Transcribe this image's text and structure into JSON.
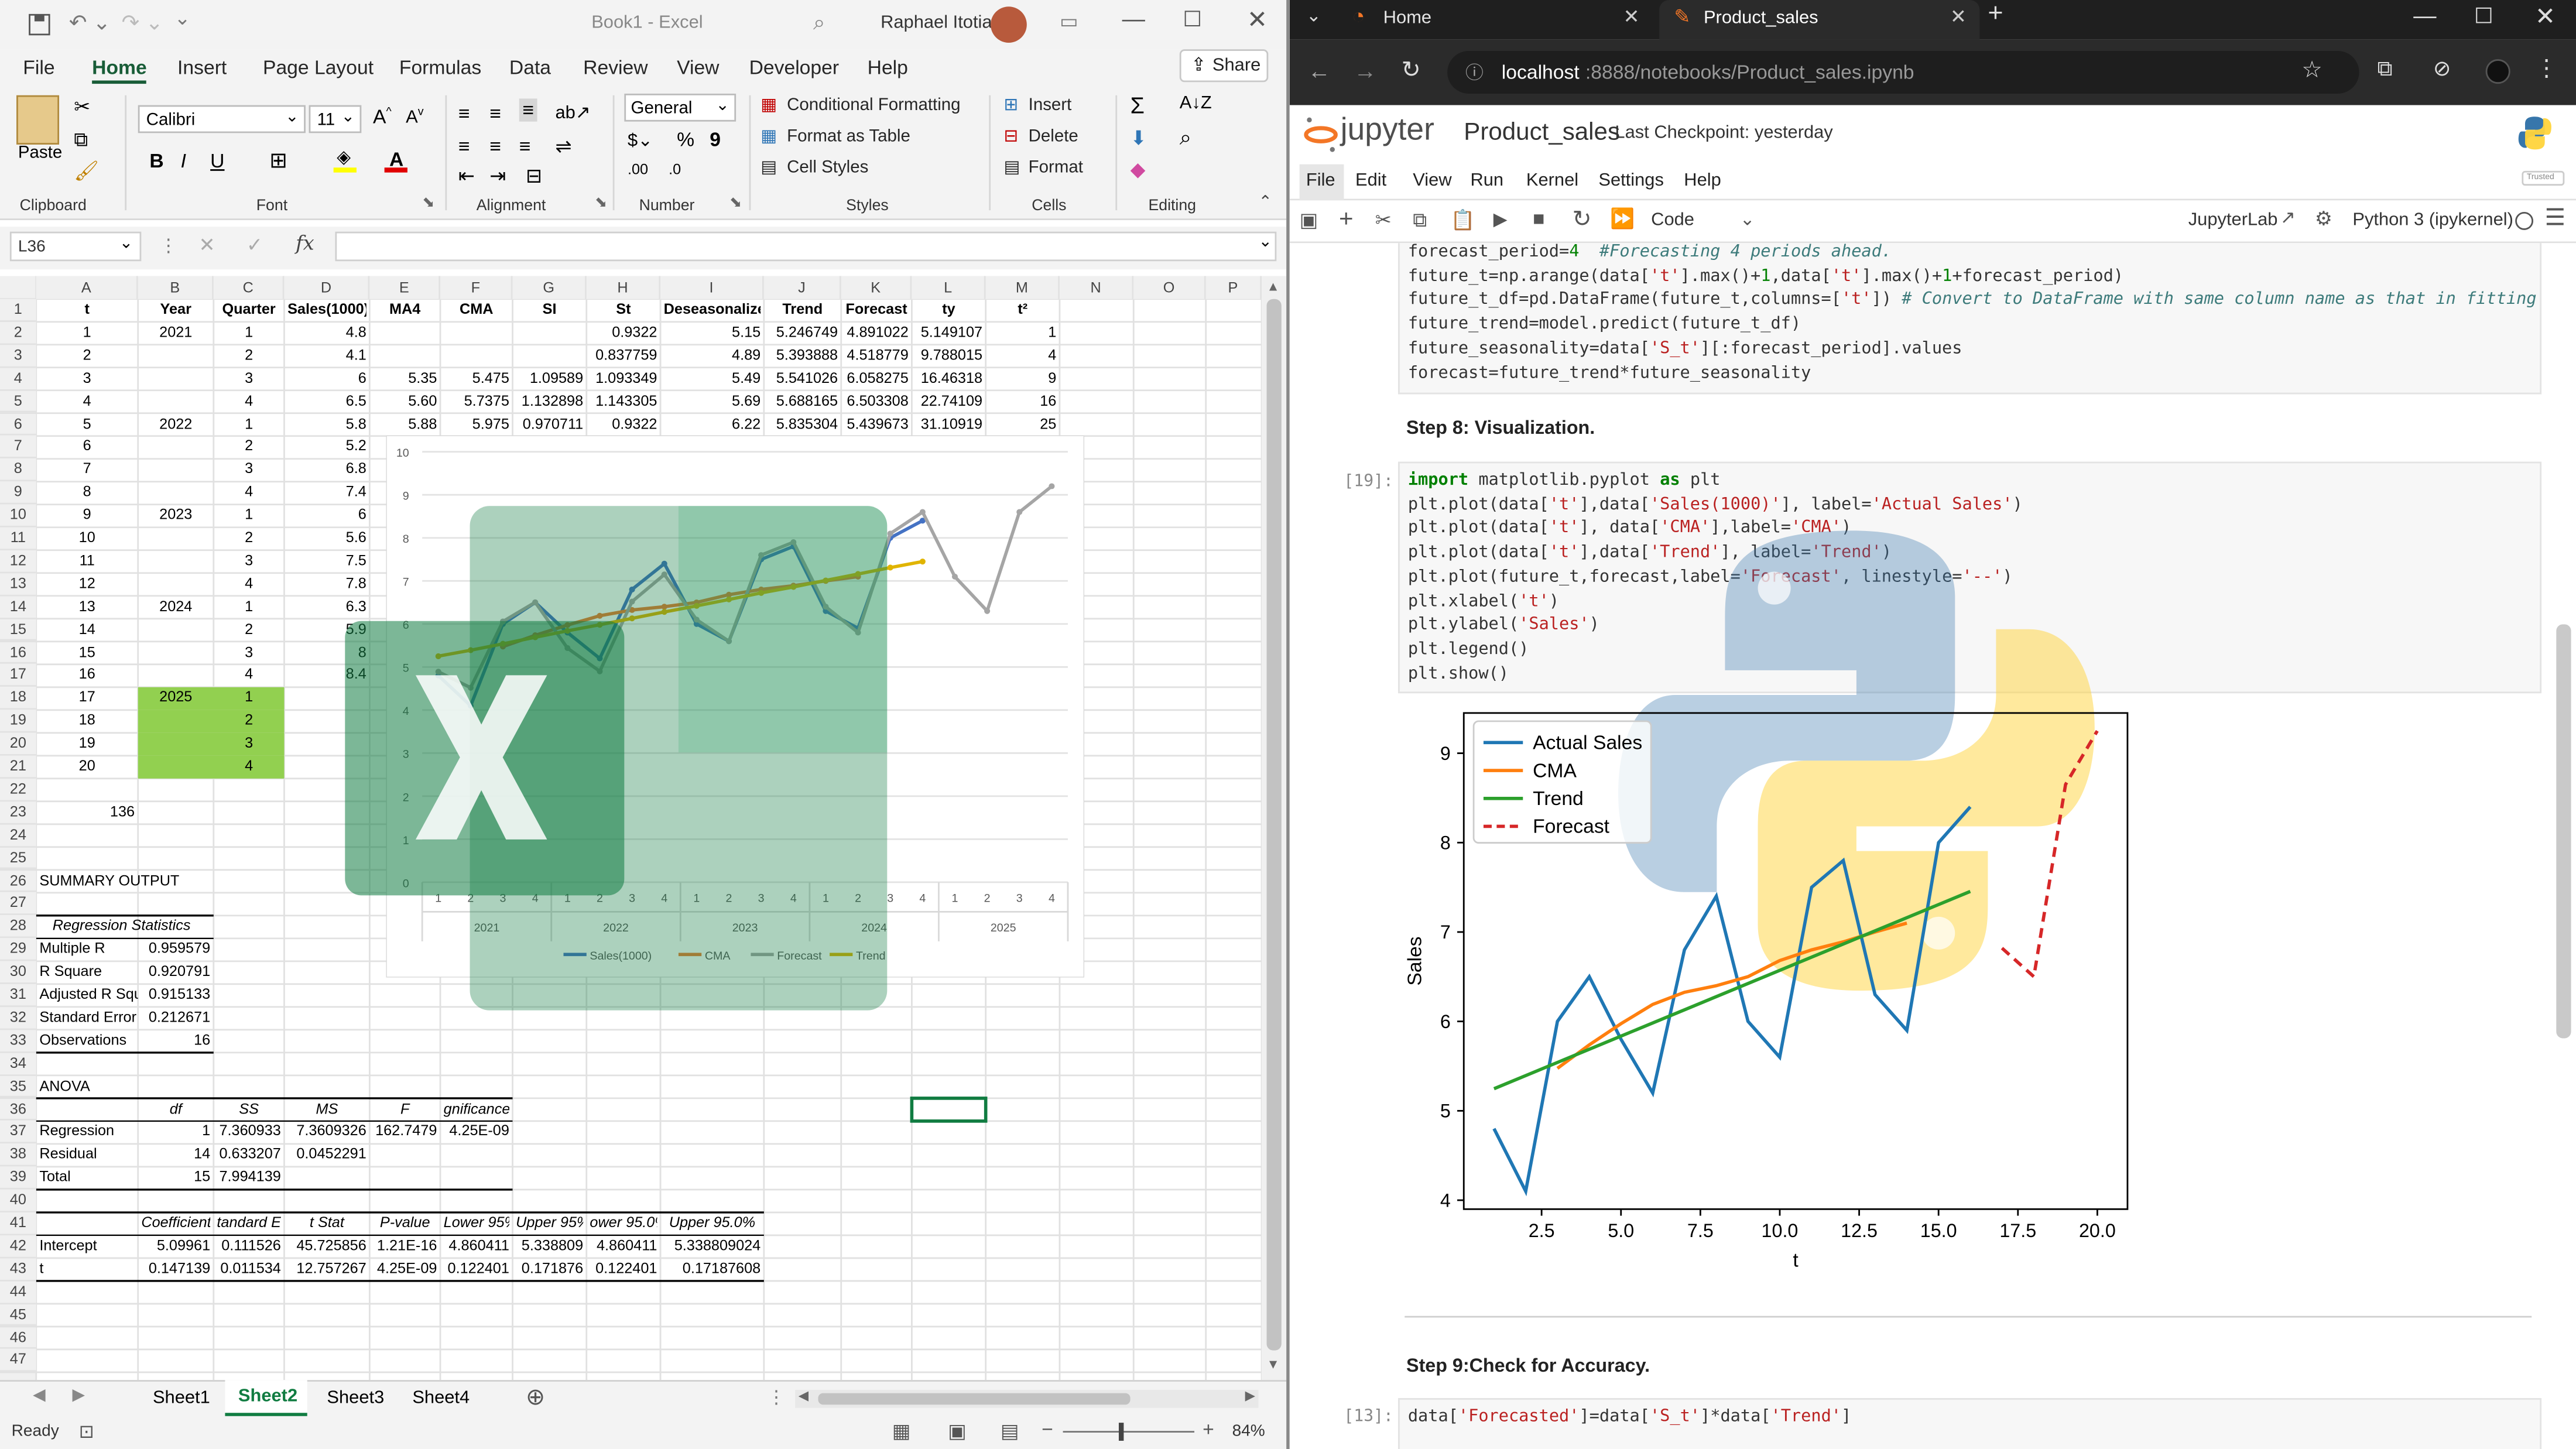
{
  "excel": {
    "title": "Book1 - Excel",
    "user": "Raphael Itotia",
    "share": "Share",
    "tabs": [
      "File",
      "Home",
      "Insert",
      "Page Layout",
      "Formulas",
      "Data",
      "Review",
      "View",
      "Developer",
      "Help"
    ],
    "font_name": "Calibri",
    "font_size": "11",
    "number_format": "General",
    "groups": [
      "Clipboard",
      "Font",
      "Alignment",
      "Number",
      "Styles",
      "Cells",
      "Editing"
    ],
    "paste": "Paste",
    "styles": [
      "Conditional Formatting",
      "Format as Table",
      "Cell Styles"
    ],
    "cells_btns": [
      "Insert",
      "Delete",
      "Format"
    ],
    "name_box": "L36",
    "fx": "fx",
    "columns": [
      "A",
      "B",
      "C",
      "D",
      "E",
      "F",
      "G",
      "H",
      "I",
      "J",
      "K",
      "L",
      "M",
      "N",
      "O",
      "P"
    ],
    "header_row": [
      "t",
      "Year",
      "Quarter",
      "Sales(1000)",
      "MA4",
      "CMA",
      "SI",
      "St",
      "Deseasonalize",
      "Trend",
      "Forecast",
      "ty",
      "t²"
    ],
    "rows": [
      [
        "1",
        "2021",
        "1",
        "4.8",
        "",
        "",
        "",
        "0.9322",
        "5.15",
        "5.246749",
        "4.891022",
        "5.149107",
        "1"
      ],
      [
        "2",
        "",
        "2",
        "4.1",
        "",
        "",
        "",
        "0.837759",
        "4.89",
        "5.393888",
        "4.518779",
        "9.788015",
        "4"
      ],
      [
        "3",
        "",
        "3",
        "6",
        "5.35",
        "5.475",
        "1.09589",
        "1.093349",
        "5.49",
        "5.541026",
        "6.058275",
        "16.46318",
        "9"
      ],
      [
        "4",
        "",
        "4",
        "6.5",
        "5.60",
        "5.7375",
        "1.132898",
        "1.143305",
        "5.69",
        "5.688165",
        "6.503308",
        "22.74109",
        "16"
      ],
      [
        "5",
        "2022",
        "1",
        "5.8",
        "5.88",
        "5.975",
        "0.970711",
        "0.9322",
        "6.22",
        "5.835304",
        "5.439673",
        "31.10919",
        "25"
      ],
      [
        "6",
        "",
        "2",
        "5.2"
      ],
      [
        "7",
        "",
        "3",
        "6.8"
      ],
      [
        "8",
        "",
        "4",
        "7.4"
      ],
      [
        "9",
        "2023",
        "1",
        "6"
      ],
      [
        "10",
        "",
        "2",
        "5.6"
      ],
      [
        "11",
        "",
        "3",
        "7.5"
      ],
      [
        "12",
        "",
        "4",
        "7.8"
      ],
      [
        "13",
        "2024",
        "1",
        "6.3"
      ],
      [
        "14",
        "",
        "2",
        "5.9"
      ],
      [
        "15",
        "",
        "3",
        "8"
      ],
      [
        "16",
        "",
        "4",
        "8.4"
      ],
      [
        "17",
        "2025",
        "1",
        ""
      ],
      [
        "18",
        "",
        "2",
        ""
      ],
      [
        "19",
        "",
        "3",
        ""
      ],
      [
        "20",
        "",
        "4",
        ""
      ]
    ],
    "a23": "136",
    "summary": "SUMMARY OUTPUT",
    "reg_stats_title": "Regression Statistics",
    "reg_stats": [
      [
        "Multiple R",
        "0.959579"
      ],
      [
        "R Square",
        "0.920791"
      ],
      [
        "Adjusted R Squ",
        "0.915133"
      ],
      [
        "Standard Error",
        "0.212671"
      ],
      [
        "Observations",
        "16"
      ]
    ],
    "anova": "ANOVA",
    "anova_head": [
      "df",
      "SS",
      "MS",
      "F",
      "gnificance F"
    ],
    "anova_rows": [
      [
        "Regression",
        "1",
        "7.360933",
        "7.3609326",
        "162.7479",
        "4.25E-09"
      ],
      [
        "Residual",
        "14",
        "0.633207",
        "0.0452291",
        "",
        ""
      ],
      [
        "Total",
        "15",
        "7.994139",
        "",
        "",
        ""
      ]
    ],
    "coef_head": [
      "Coefficients",
      "tandard Err",
      "t Stat",
      "P-value",
      "Lower 95%",
      "Upper 95%",
      "ower 95.0%",
      "Upper 95.0%"
    ],
    "coef_rows": [
      [
        "Intercept",
        "5.09961",
        "0.111526",
        "45.725856",
        "1.21E-16",
        "4.860411",
        "5.338809",
        "4.860411",
        "5.338809024"
      ],
      [
        "t",
        "0.147139",
        "0.011534",
        "12.757267",
        "4.25E-09",
        "0.122401",
        "0.171876",
        "0.122401",
        "0.17187608"
      ]
    ],
    "sheets": [
      "Sheet1",
      "Sheet2",
      "Sheet3",
      "Sheet4"
    ],
    "status": "Ready",
    "zoom": "84%",
    "chart": {
      "y_ticks": [
        "0",
        "1",
        "2",
        "3",
        "4",
        "5",
        "6",
        "7",
        "8",
        "9",
        "10"
      ],
      "q_labels": [
        "1",
        "2",
        "3",
        "4",
        "1",
        "2",
        "3",
        "4",
        "1",
        "2",
        "3",
        "4",
        "1",
        "2",
        "3",
        "4",
        "1",
        "2",
        "3",
        "4"
      ],
      "years": [
        "2021",
        "2022",
        "2023",
        "2024",
        "2025"
      ],
      "legend": [
        "Sales(1000)",
        "CMA",
        "Forecast",
        "Trend"
      ]
    }
  },
  "browser": {
    "tabs": [
      "Home",
      "Product_sales"
    ],
    "url_host": "localhost",
    "url_rest": ":8888/notebooks/Product_sales.ipynb",
    "logo": "jupyter",
    "nb_title": "Product_sales",
    "checkpoint": "Last Checkpoint: yesterday",
    "menu": [
      "File",
      "Edit",
      "View",
      "Run",
      "Kernel",
      "Settings",
      "Help"
    ],
    "trusted": "Trusted",
    "cell_type": "Code",
    "jlab": "JupyterLab",
    "kernel": "Python 3 (ipykernel)",
    "step8": "Step 8: Visualization.",
    "step9": "Step 9:Check for Accuracy.",
    "prompt19": "[19]:",
    "prompt13": "[13]:",
    "plot": {
      "xlabel": "t",
      "ylabel": "Sales",
      "xticks": [
        "2.5",
        "5.0",
        "7.5",
        "10.0",
        "12.5",
        "15.0",
        "17.5",
        "20.0"
      ],
      "yticks": [
        "4",
        "5",
        "6",
        "7",
        "8",
        "9"
      ],
      "legend": [
        "Actual Sales",
        "CMA",
        "Trend",
        "Forecast"
      ]
    }
  },
  "chart_data": [
    {
      "type": "line",
      "xlabel": "t",
      "ylabel": "Sales",
      "xlim": [
        0.05,
        20.95
      ],
      "ylim": [
        3.9,
        9.45
      ],
      "series": [
        {
          "name": "Actual Sales",
          "color": "#1f77b4",
          "x": [
            1,
            2,
            3,
            4,
            5,
            6,
            7,
            8,
            9,
            10,
            11,
            12,
            13,
            14,
            15,
            16
          ],
          "y": [
            4.8,
            4.1,
            6,
            6.5,
            5.8,
            5.2,
            6.8,
            7.4,
            6,
            5.6,
            7.5,
            7.8,
            6.3,
            5.9,
            8,
            8.4
          ]
        },
        {
          "name": "CMA",
          "color": "#ff7f0e",
          "x": [
            3,
            4,
            5,
            6,
            7,
            8,
            9,
            10,
            11,
            12,
            13,
            14
          ],
          "y": [
            5.475,
            5.7375,
            5.975,
            6.19,
            6.325,
            6.4,
            6.5,
            6.68,
            6.8,
            6.89,
            7.0,
            7.1
          ]
        },
        {
          "name": "Trend",
          "color": "#2ca02c",
          "x": [
            1,
            16
          ],
          "y": [
            5.246749,
            7.454
          ]
        },
        {
          "name": "Forecast",
          "color": "#d62728",
          "x": [
            17,
            18,
            19,
            20
          ],
          "y": [
            6.82,
            6.5,
            8.65,
            9.25
          ]
        }
      ]
    },
    {
      "type": "line",
      "categories": [
        "1",
        "2",
        "3",
        "4",
        "1",
        "2",
        "3",
        "4",
        "1",
        "2",
        "3",
        "4",
        "1",
        "2",
        "3",
        "4",
        "1",
        "2",
        "3",
        "4"
      ],
      "ylim": [
        0,
        10
      ],
      "series": [
        {
          "name": "Sales(1000)",
          "color": "#4472c4",
          "y": [
            4.8,
            4.1,
            6,
            6.5,
            5.8,
            5.2,
            6.8,
            7.4,
            6,
            5.6,
            7.5,
            7.8,
            6.3,
            5.9,
            8,
            8.4
          ]
        },
        {
          "name": "CMA",
          "color": "#ed7d31",
          "y": [
            null,
            null,
            5.475,
            5.7375,
            5.975,
            6.19,
            6.325,
            6.4,
            6.5,
            6.68,
            6.8,
            6.89,
            7.0,
            7.1,
            null,
            null
          ]
        },
        {
          "name": "Forecast",
          "color": "#a5a5a5",
          "y": [
            4.891,
            4.519,
            6.058,
            6.503,
            5.44,
            4.9,
            6.52,
            7.15,
            6.1,
            5.6,
            7.6,
            7.9,
            6.4,
            5.8,
            8.1,
            8.6,
            7.1,
            6.3,
            8.6,
            9.2
          ]
        },
        {
          "name": "Trend",
          "color": "#e0b400",
          "y": [
            5.25,
            5.39,
            5.54,
            5.69,
            5.84,
            5.98,
            6.13,
            6.28,
            6.42,
            6.57,
            6.72,
            6.86,
            7.01,
            7.16,
            7.31,
            7.45
          ]
        }
      ]
    }
  ]
}
